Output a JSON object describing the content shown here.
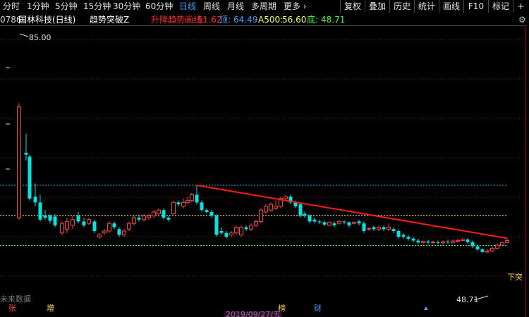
{
  "toolbar": {
    "periods": [
      "分时",
      "1分钟",
      "5分钟",
      "15分钟",
      "30分钟",
      "60分钟",
      "日线",
      "周线",
      "月线",
      "多周期",
      "更多"
    ],
    "more_arrow": "›",
    "active_index": 6,
    "tools": [
      "复权",
      "叠加",
      "历史",
      "统计",
      "画线",
      "F10",
      "标记"
    ],
    "plus": "+",
    "edge": "白"
  },
  "info": {
    "code_fragment": "0786",
    "title": "国林科技(日线)",
    "indicator": "趋势突破Z",
    "line_label": "升降趋势画线:",
    "line_value": "51.62",
    "top_label": "顶:",
    "top_value": "64.49",
    "a500_label": "A500:",
    "a500_value": "56.60",
    "bottom_label": "底:",
    "bottom_value": "48.71"
  },
  "chart": {
    "high_label": "85.00",
    "low_label": "48.71",
    "breakout_label": "下突",
    "watermark": "未来数据",
    "markers": {
      "zhang": "张",
      "zeng": "增",
      "bang": "榜",
      "cai": "财"
    },
    "date_label": "2019/09/27/五",
    "levels": {
      "top": 64.49,
      "a500": 56.6,
      "bottom": 48.71
    },
    "colors": {
      "up": "#ff4040",
      "down": "#00e5e5",
      "trend": "#ff1a1a",
      "top": "#2aa8d8",
      "a500": "#ffff50",
      "bottom": "#40ff40",
      "grid": "#8b1a1a"
    }
  }
}
